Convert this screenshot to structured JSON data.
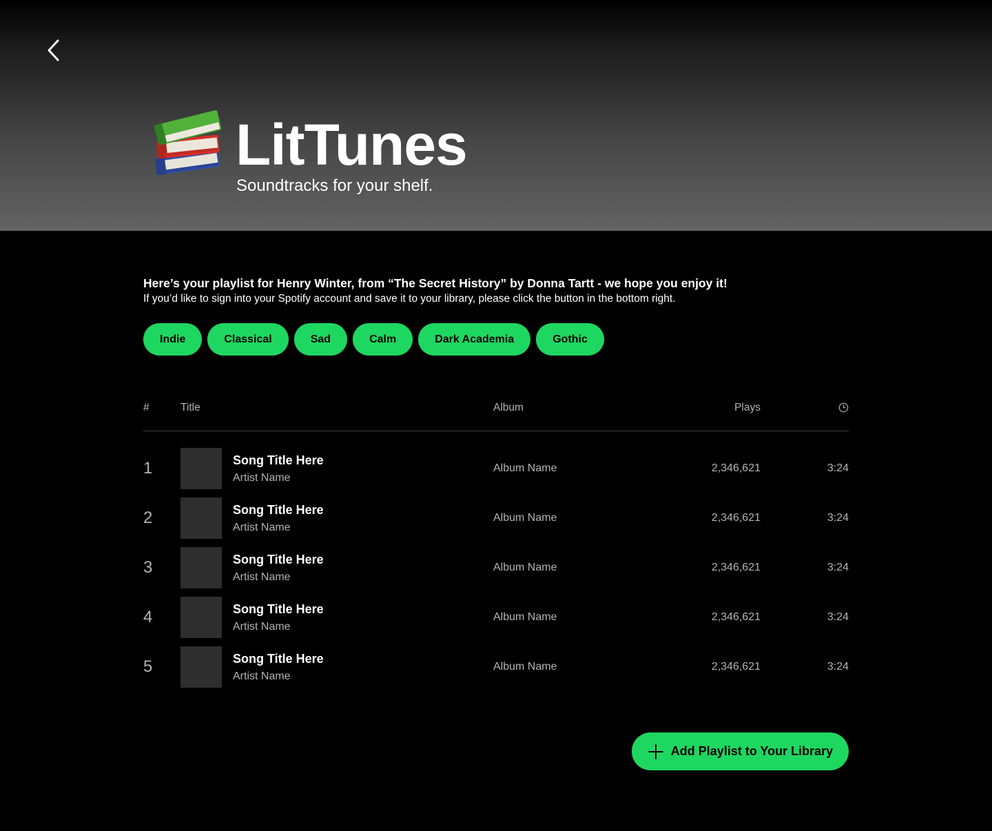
{
  "header": {
    "title": "LitTunes",
    "tagline": "Soundtracks for your shelf.",
    "logo_icon": "books-icon",
    "back_icon": "chevron-left-icon"
  },
  "intro": {
    "heading": "Here’s your playlist for Henry Winter, from “The Secret History” by Donna Tartt - we hope you enjoy it!",
    "text": "If you’d like to sign into your Spotify account and save it to your library, please click the button in the bottom right."
  },
  "tags": [
    "Indie",
    "Classical",
    "Sad",
    "Calm",
    "Dark Academia",
    "Gothic"
  ],
  "table": {
    "headers": {
      "number": "#",
      "title": "Title",
      "album": "Album",
      "plays": "Plays",
      "duration_icon": "clock-icon"
    },
    "rows": [
      {
        "number": "1",
        "title": "Song Title Here",
        "artist": "Artist Name",
        "album": "Album Name",
        "plays": "2,346,621",
        "duration": "3:24"
      },
      {
        "number": "2",
        "title": "Song Title Here",
        "artist": "Artist Name",
        "album": "Album Name",
        "plays": "2,346,621",
        "duration": "3:24"
      },
      {
        "number": "3",
        "title": "Song Title Here",
        "artist": "Artist Name",
        "album": "Album Name",
        "plays": "2,346,621",
        "duration": "3:24"
      },
      {
        "number": "4",
        "title": "Song Title Here",
        "artist": "Artist Name",
        "album": "Album Name",
        "plays": "2,346,621",
        "duration": "3:24"
      },
      {
        "number": "5",
        "title": "Song Title Here",
        "artist": "Artist Name",
        "album": "Album Name",
        "plays": "2,346,621",
        "duration": "3:24"
      }
    ]
  },
  "cta": {
    "label": "Add Playlist to Your Library",
    "icon": "plus-icon"
  },
  "colors": {
    "accent": "#1ed760",
    "background": "#000000",
    "cover_placeholder": "#2e2e2e",
    "muted_text": "#b3b3b3"
  }
}
